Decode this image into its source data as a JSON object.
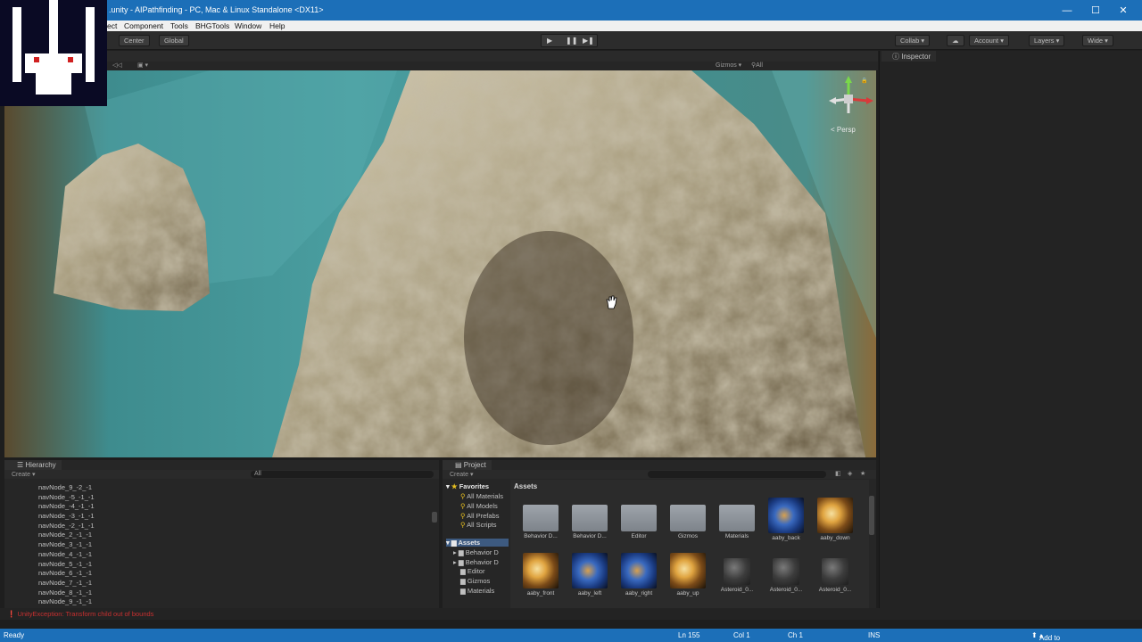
{
  "window": {
    "title": ".unity - AIPathfinding - PC, Mac & Linux Standalone <DX11>",
    "minimize": "—",
    "maximize": "☐",
    "close": "✕"
  },
  "menu": {
    "items": [
      "ect",
      "Component",
      "Tools",
      "BHGTools",
      "Window",
      "Help"
    ]
  },
  "toolbar": {
    "center": "Center",
    "global": "Global",
    "play": "▶",
    "pause": "❚❚",
    "step": "▶❚",
    "collab": "Collab",
    "account": "Account",
    "layers": "Layers",
    "layout": "Wide"
  },
  "scene": {
    "gizmos": "Gizmos",
    "search": "All",
    "persp": "< Persp"
  },
  "inspector": {
    "tab": "Inspector"
  },
  "hierarchy": {
    "tab": "Hierarchy",
    "create": "Create",
    "search": "All",
    "rows": [
      "navNode_9_-2_-1",
      "navNode_-5_-1_-1",
      "navNode_-4_-1_-1",
      "navNode_-3_-1_-1",
      "navNode_-2_-1_-1",
      "navNode_2_-1_-1",
      "navNode_3_-1_-1",
      "navNode_4_-1_-1",
      "navNode_5_-1_-1",
      "navNode_6_-1_-1",
      "navNode_7_-1_-1",
      "navNode_8_-1_-1",
      "navNode_9_-1_-1"
    ]
  },
  "project": {
    "tab": "Project",
    "create": "Create",
    "breadcrumb": "Assets",
    "favorites": "Favorites",
    "fav_items": [
      "All Materials",
      "All Models",
      "All Prefabs",
      "All Scripts"
    ],
    "assets_root": "Assets",
    "tree_items": [
      "Behavior D",
      "Behavior D",
      "Editor",
      "Gizmos",
      "Materials"
    ],
    "assets_row1": [
      "Behavior D...",
      "Behavior D...",
      "Editor",
      "Gizmos",
      "Materials",
      "aaby_back",
      "aaby_down"
    ],
    "assets_row2": [
      "aaby_front",
      "aaby_left",
      "aaby_right",
      "aaby_up",
      "Asteroid_0...",
      "Asteroid_0...",
      "Asteroid_0..."
    ]
  },
  "console": {
    "error": "UnityException: Transform child out of bounds"
  },
  "status": {
    "ready": "Ready",
    "line": "Ln 155",
    "col": "Col 1",
    "ch": "Ch 1",
    "ins": "INS",
    "source_control": "Add to Source Control"
  }
}
